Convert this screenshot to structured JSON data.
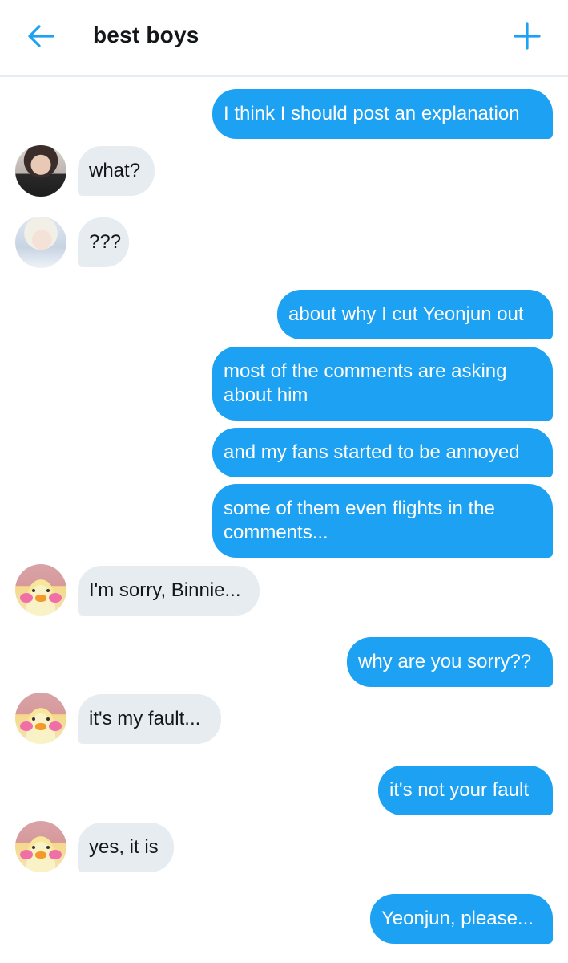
{
  "header": {
    "title": "best boys",
    "back_icon": "arrow-left-icon",
    "add_icon": "plus-icon",
    "accent": "#1da1f2"
  },
  "colors": {
    "outgoing_bubble": "#1da1f2",
    "incoming_bubble": "#e6ecf0",
    "divider": "#e6ecf0"
  },
  "messages": [
    {
      "dir": "out",
      "text": "I think I should post an explanation"
    },
    {
      "dir": "in",
      "avatar": "boy1",
      "text": "what?"
    },
    {
      "dir": "in",
      "avatar": "boy2",
      "text": "???"
    },
    {
      "dir": "out",
      "text": "about why I cut Yeonjun out"
    },
    {
      "dir": "out",
      "text": "most of the comments are asking about him"
    },
    {
      "dir": "out",
      "text": "and my fans started to be annoyed"
    },
    {
      "dir": "out",
      "text": "some of them even flights in the comments..."
    },
    {
      "dir": "in",
      "avatar": "duck",
      "text": "I'm sorry, Binnie..."
    },
    {
      "dir": "out",
      "text": "why are you sorry??"
    },
    {
      "dir": "in",
      "avatar": "duck",
      "text": "it's my fault..."
    },
    {
      "dir": "out",
      "text": "it's not your fault"
    },
    {
      "dir": "in",
      "avatar": "duck",
      "text": "yes, it is"
    },
    {
      "dir": "out",
      "text": "Yeonjun, please..."
    }
  ]
}
